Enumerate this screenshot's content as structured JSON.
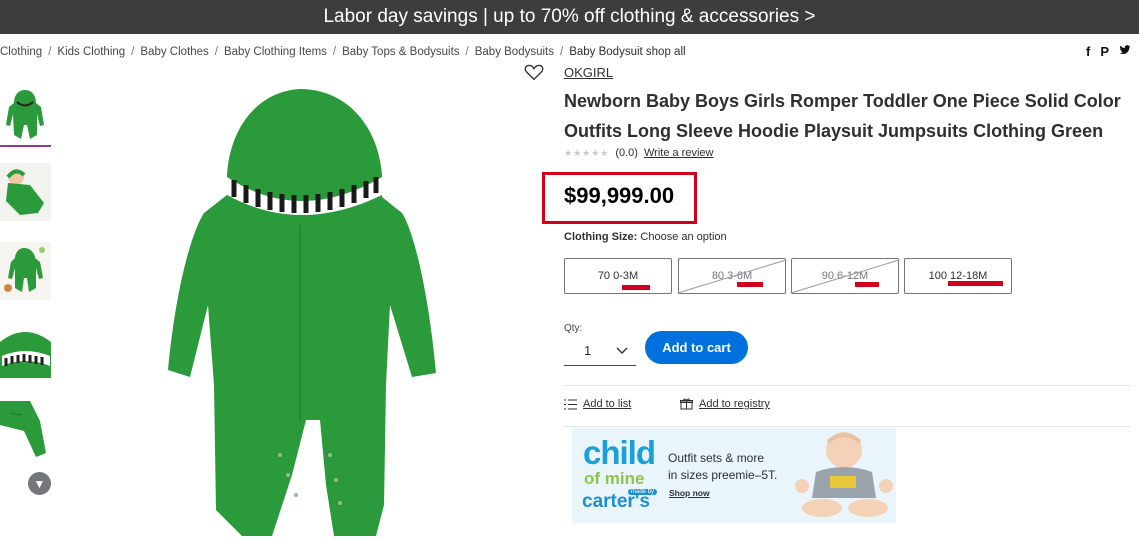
{
  "banner": {
    "text": "Labor day savings | up to 70% off clothing & accessories >"
  },
  "breadcrumbs": [
    "Clothing",
    "Kids Clothing",
    "Baby Clothes",
    "Baby Clothing Items",
    "Baby Tops & Bodysuits",
    "Baby Bodysuits",
    "Baby Bodysuit shop all"
  ],
  "share_icons": [
    "facebook-icon",
    "pinterest-icon",
    "twitter-icon"
  ],
  "product": {
    "brand": "OKGIRL",
    "title_line1": "Newborn Baby Boys Girls Romper Toddler One Piece Solid Color",
    "title_line2": "Outfits Long Sleeve Hoodie Playsuit Jumpsuits Clothing Green",
    "rating_value": "(0.0)",
    "write_review": "Write a review",
    "price": "$99,999.00",
    "size_label": "Clothing Size:",
    "size_prompt": "Choose an option",
    "sizes": [
      "70 0-3M",
      "80 3-6M",
      "90 6-12M",
      "100 12-18M"
    ],
    "sizes_unavailable": [
      false,
      true,
      true,
      false
    ],
    "qty_label": "Qty:",
    "qty_value": "1",
    "add_to_cart": "Add to cart",
    "add_to_list": "Add to list",
    "add_to_registry": "Add to registry"
  },
  "ad": {
    "logo_child": "child",
    "logo_of_mine": "of mine",
    "logo_made_by": "made by",
    "logo_carters": "carter's",
    "line1": "Outfit sets & more",
    "line2": "in sizes preemie–5T.",
    "cta": "Shop now"
  },
  "colors": {
    "accent_blue": "#0071dc",
    "annotation_red": "#d0021b",
    "product_green": "#2a9a3a"
  }
}
